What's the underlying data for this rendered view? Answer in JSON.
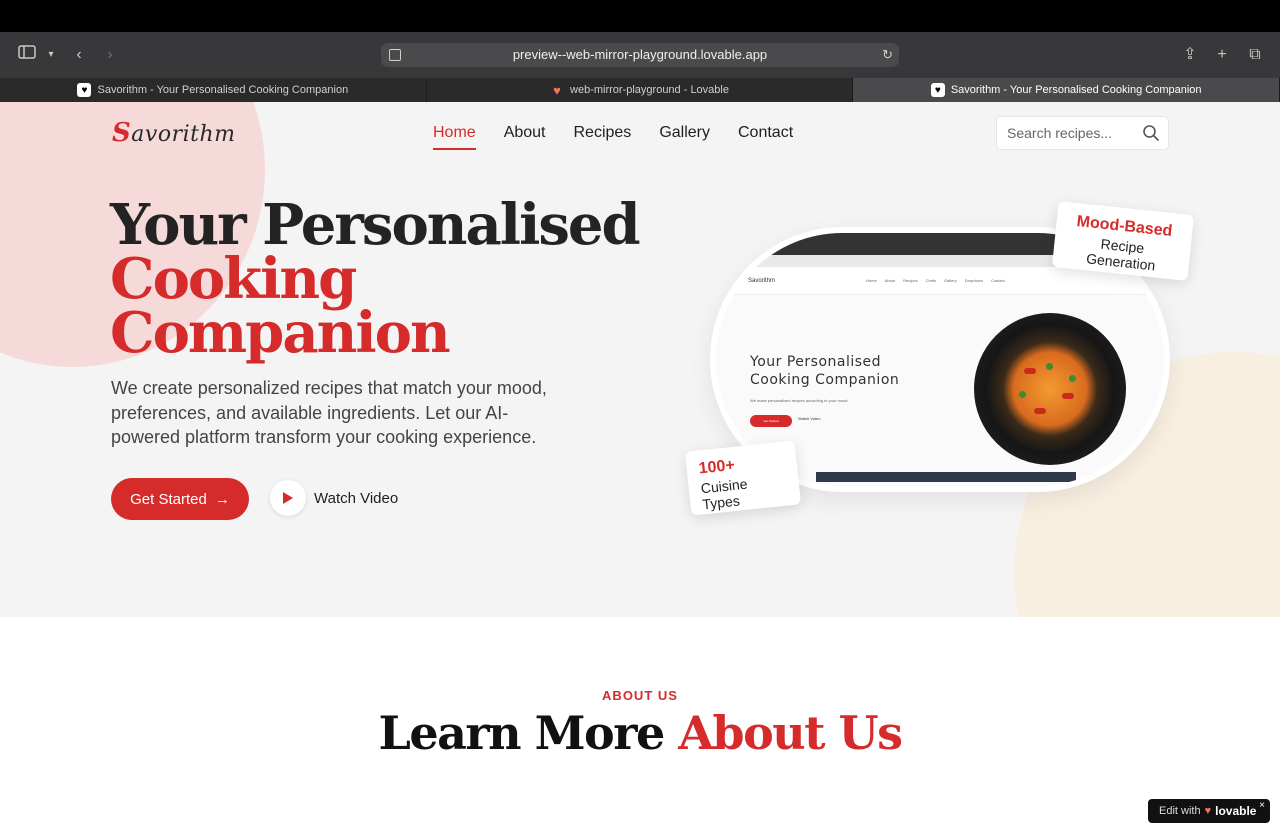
{
  "browser": {
    "url": "preview--web-mirror-playground.lovable.app",
    "tabs": [
      {
        "title": "Savorithm - Your Personalised Cooking Companion",
        "active": false,
        "icon": "heart-favicon-white"
      },
      {
        "title": "web-mirror-playground - Lovable",
        "active": false,
        "icon": "lovable-heart-favicon"
      },
      {
        "title": "Savorithm - Your Personalised Cooking Companion",
        "active": true,
        "icon": "heart-favicon-white"
      }
    ]
  },
  "site": {
    "logo_first": "S",
    "logo_rest": "avorithm",
    "nav": [
      {
        "label": "Home",
        "active": true
      },
      {
        "label": "About",
        "active": false
      },
      {
        "label": "Recipes",
        "active": false
      },
      {
        "label": "Gallery",
        "active": false
      },
      {
        "label": "Contact",
        "active": false
      }
    ],
    "search_placeholder": "Search recipes..."
  },
  "hero": {
    "title_line1": "Your Personalised",
    "title_line2": "Cooking",
    "title_line3": "Companion",
    "subtitle": "We create personalized recipes that match your mood, preferences, and available ingredients. Let our AI-powered platform transform your cooking experience.",
    "cta_primary": "Get Started",
    "cta_secondary": "Watch Video"
  },
  "preview": {
    "logo": "Savorithm",
    "links": [
      "Home",
      "About",
      "Recipes",
      "Chefs",
      "Gallery",
      "Dropdown",
      "Contact"
    ],
    "title": "Your Personalised Cooking Companion",
    "desc": "We make personalised recipes according to your mood.",
    "btn": "Get Started",
    "watch": "Watch Video"
  },
  "badges": {
    "mood_title": "Mood-Based",
    "mood_sub": "Recipe Generation",
    "cuisine_title": "100+",
    "cuisine_sub": "Cuisine Types"
  },
  "about": {
    "eyebrow": "ABOUT US",
    "title_dark": "Learn More",
    "title_red": "About Us"
  },
  "lovable": {
    "prefix": "Edit with",
    "brand": "lovable",
    "close": "×"
  },
  "colors": {
    "accent": "#d52b2b",
    "hero_bg": "#f4f4f5",
    "blob_pink": "#f6dada",
    "blob_cream": "#f8efe1"
  }
}
